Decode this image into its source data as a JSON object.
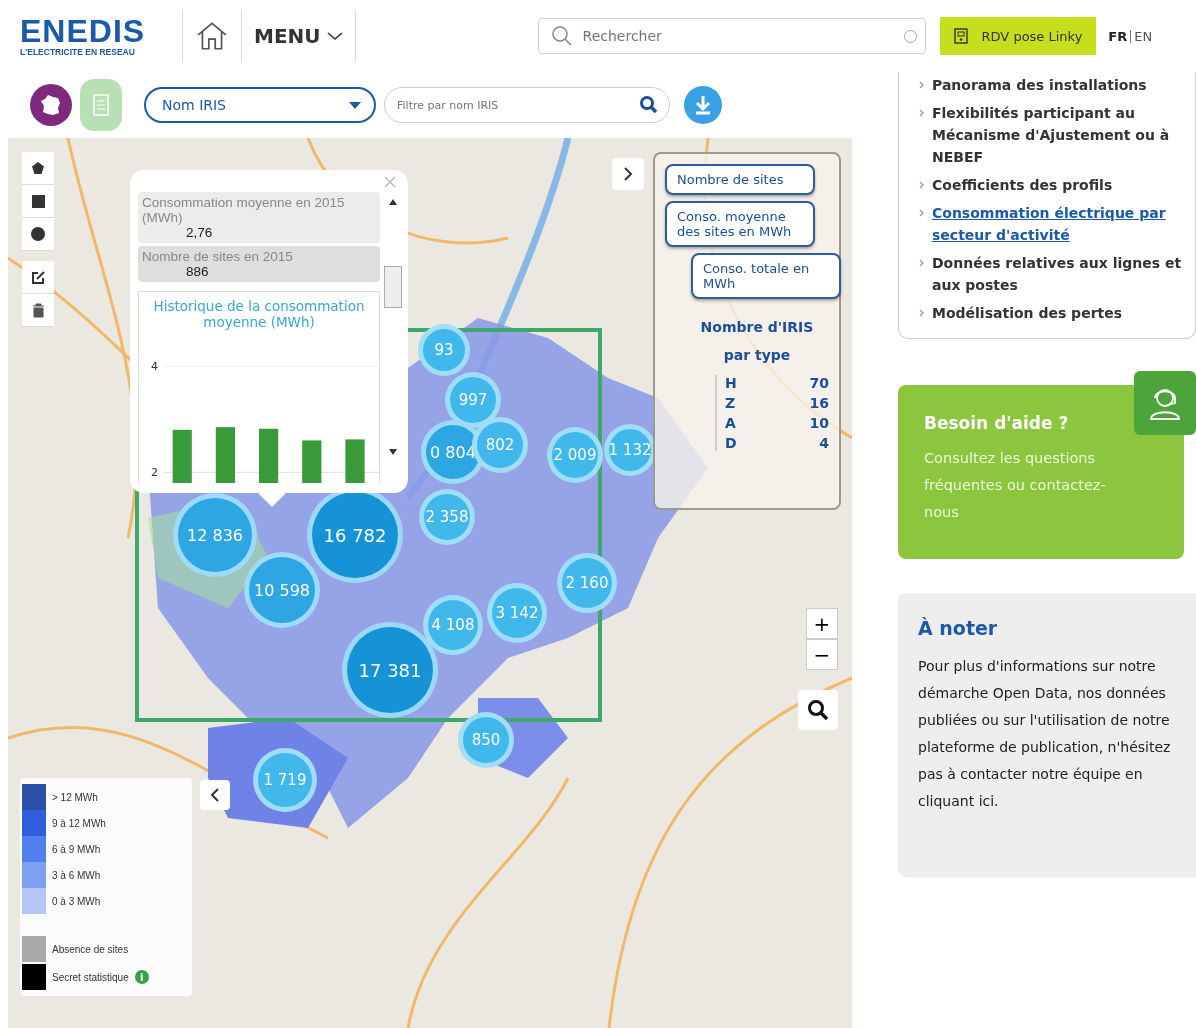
{
  "header": {
    "logo": {
      "name": "ENEDIS",
      "tagline": "L'ELECTRICITE EN RESEAU"
    },
    "menu": "MENU",
    "search": {
      "placeholder": "Rechercher"
    },
    "cta": "RDV pose Linky",
    "languages": [
      {
        "label": "FR",
        "selected": true
      },
      {
        "label": "EN",
        "selected": false
      }
    ]
  },
  "toolbar": {
    "select": "Nom IRIS",
    "filter": {
      "placeholder": "Filtre par nom IRIS"
    }
  },
  "map": {
    "clusters": [
      "93",
      "997",
      "0 804",
      "802",
      "2 009",
      "1 132",
      "12 836",
      "16 782",
      "2 358",
      "10 598",
      "2 160",
      "4 108",
      "3 142",
      "17 381",
      "850",
      "1 719"
    ],
    "popup": {
      "fields": [
        {
          "label": "Consommation moyenne en 2015 (MWh)",
          "value": "2,76"
        },
        {
          "label": "Nombre de sites en 2015",
          "value": "886"
        }
      ],
      "chart_data": {
        "type": "bar",
        "title": "Historique de la consommation moyenne (MWh)",
        "values": [
          2.8,
          2.85,
          2.82,
          2.6,
          2.62
        ],
        "yticks": [
          2,
          4
        ],
        "ylim": [
          1.8,
          4
        ]
      }
    },
    "layers": [
      {
        "label": "Nombre de sites"
      },
      {
        "label": "Conso. moyenne des sites en MWh"
      },
      {
        "label": "Conso. totale en MWh"
      }
    ],
    "iris_types": {
      "title": "Nombre d'IRIS par type",
      "rows": [
        {
          "type": "H",
          "count": "70"
        },
        {
          "type": "Z",
          "count": "16"
        },
        {
          "type": "A",
          "count": "10"
        },
        {
          "type": "D",
          "count": "4"
        }
      ]
    },
    "zoom": {
      "in": "+",
      "out": "−"
    },
    "legend": [
      {
        "label": "> 12 MWh",
        "color": "#2c4fa8"
      },
      {
        "label": "9 à 12 MWh",
        "color": "#2f5fdc"
      },
      {
        "label": "6 à 9 MWh",
        "color": "#4f80ee"
      },
      {
        "label": "3 à 6 MWh",
        "color": "#7d9ff2"
      },
      {
        "label": "0 à 3 MWh",
        "color": "#b3c6f5"
      },
      {
        "label": "Absence de sites",
        "color": "#a9a9a9"
      },
      {
        "label": "Secret statistique",
        "color": "#000000"
      }
    ],
    "legend_info": "i"
  },
  "sidebar": {
    "links": [
      {
        "label": "Panorama des installations",
        "selected": false
      },
      {
        "label": "Flexibilités participant au Mécanisme d'Ajustement ou à NEBEF",
        "selected": false
      },
      {
        "label": "Coefficients des profils",
        "selected": false
      },
      {
        "label": "Consommation électrique par secteur d'activité",
        "selected": true
      },
      {
        "label": "Données relatives aux lignes et aux postes",
        "selected": false
      },
      {
        "label": "Modélisation des pertes",
        "selected": false
      }
    ],
    "help": {
      "title": "Besoin d'aide ?",
      "text": "Consultez les questions fréquentes ou contactez-nous"
    },
    "note": {
      "title": "À noter",
      "text": "Pour plus d'informations sur notre démarche Open Data, nos données publiées ou sur l'utilisation de notre plateforme de publication, n'hésitez pas à contacter notre équipe en cliquant ici."
    }
  }
}
